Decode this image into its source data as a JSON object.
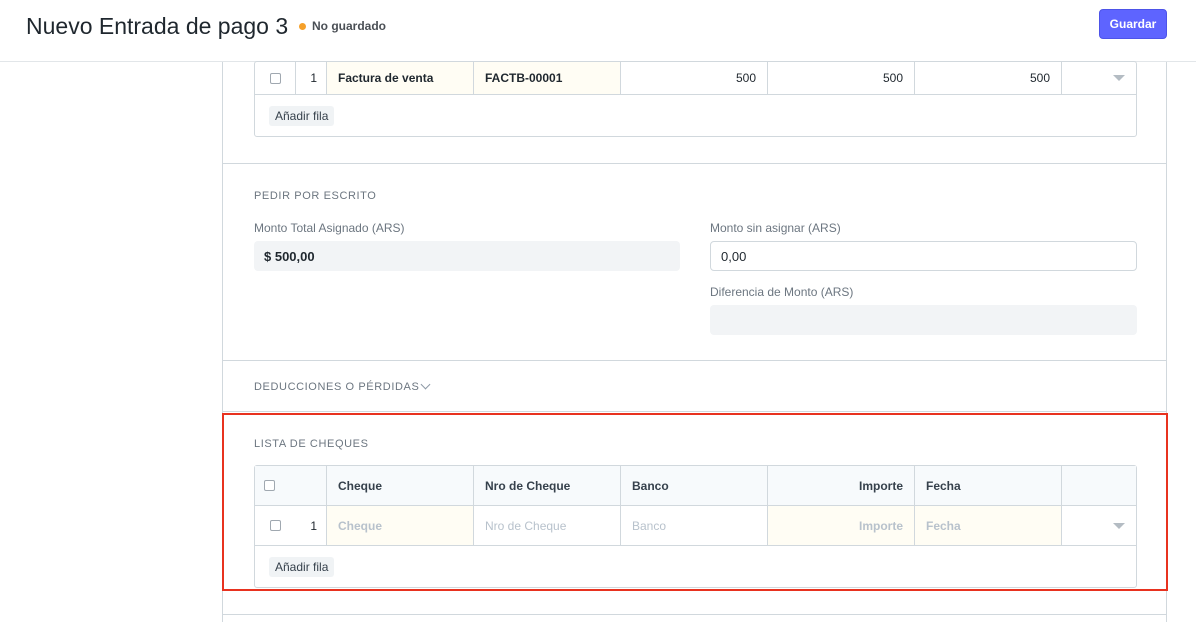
{
  "header": {
    "title": "Nuevo Entrada de pago 3",
    "status": "No guardado",
    "save_label": "Guardar"
  },
  "references_table": {
    "rows": [
      {
        "index": "1",
        "type": "Factura de venta",
        "name": "FACTB-00001",
        "total": "500",
        "outstanding": "500",
        "allocated": "500"
      }
    ],
    "add_row_label": "Añadir fila"
  },
  "write_off": {
    "section_label": "PEDIR POR ESCRITO",
    "total_allocated_label": "Monto Total Asignado (ARS)",
    "total_allocated_value": "$ 500,00",
    "unallocated_label": "Monto sin asignar (ARS)",
    "unallocated_value": "0,00",
    "difference_label": "Diferencia de Monto (ARS)",
    "difference_value": ""
  },
  "deductions": {
    "section_label": "DEDUCCIONES O PÉRDIDAS"
  },
  "cheques": {
    "section_label": "LISTA DE CHEQUES",
    "columns": [
      "Cheque",
      "Nro de Cheque",
      "Banco",
      "Importe",
      "Fecha"
    ],
    "rows": [
      {
        "index": "1",
        "cheque": "Cheque",
        "number": "Nro de Cheque",
        "bank": "Banco",
        "amount": "Importe",
        "date": "Fecha"
      }
    ],
    "add_row_label": "Añadir fila"
  }
}
